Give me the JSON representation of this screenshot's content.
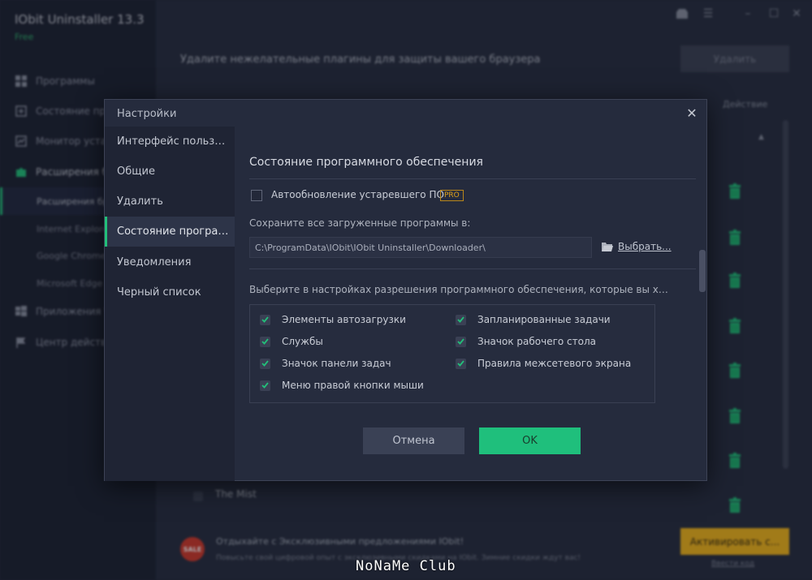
{
  "app": {
    "title": "IObit Uninstaller 13.3",
    "edition": "Free"
  },
  "sidebar": {
    "items": [
      {
        "label": "Программы",
        "icon": "grid-icon"
      },
      {
        "label": "Состояние программ",
        "icon": "update-icon"
      },
      {
        "label": "Монитор установки",
        "icon": "monitor-icon"
      },
      {
        "label": "Расширения браузеров",
        "icon": "puzzle-icon"
      },
      {
        "label": "Приложения Windows",
        "icon": "windows-icon"
      },
      {
        "label": "Центр действий",
        "icon": "flag-icon"
      }
    ],
    "subitems": [
      {
        "label": "Расширения браузеров"
      },
      {
        "label": "Internet Explorer"
      },
      {
        "label": "Google Chrome"
      },
      {
        "label": "Microsoft Edge"
      }
    ]
  },
  "main": {
    "headline": "Удалите нежелательные плагины для защиты вашего браузера",
    "remove_label": "Удалить",
    "action_col": "Действие",
    "row_name": "The Mist",
    "promo_badge": "SALE",
    "promo_title": "Отдыхайте с Эксклюзивными предложениями IObit!",
    "promo_sub": "Повысьте свой цифровой опыт с эксклюзивными скидками на IObit. Зимние скидки ждут вас!",
    "activate_label": "Активировать с...",
    "enter_code": "Ввести код"
  },
  "watermark": "NoNaMe Club",
  "dialog": {
    "title": "Настройки",
    "nav": [
      "Интерфейс пользователя",
      "Общие",
      "Удалить",
      "Состояние программного обеспечения",
      "Уведомления",
      "Черный список"
    ],
    "active_index": 3,
    "section_title": "Состояние программного обеспечения",
    "auto_update": {
      "label": "Автообновление устаревшего ПО",
      "checked": false,
      "badge": "PRO"
    },
    "save_label": "Сохраните все загруженные программы в:",
    "path": "C:\\ProgramData\\IObit\\IObit Uninstaller\\Downloader\\",
    "browse_label": "Выбрать...",
    "choose_label": "Выберите в настройках разрешения программного обеспечения, которые вы хотите удалить",
    "permissions": [
      {
        "label": "Элементы автозагрузки",
        "checked": true
      },
      {
        "label": "Запланированные задачи",
        "checked": true
      },
      {
        "label": "Службы",
        "checked": true
      },
      {
        "label": "Значок рабочего стола",
        "checked": true
      },
      {
        "label": "Значок панели задач",
        "checked": true
      },
      {
        "label": "Правила межсетевого экрана",
        "checked": true
      },
      {
        "label": "Меню правой кнопки мыши",
        "checked": true
      }
    ],
    "cancel_label": "Отмена",
    "ok_label": "OK"
  },
  "colors": {
    "accent": "#1fbf7c",
    "background": "#22283a",
    "dialog": "#252b3d",
    "pro_badge": "#e0a31c",
    "activate": "#f2b51b"
  }
}
